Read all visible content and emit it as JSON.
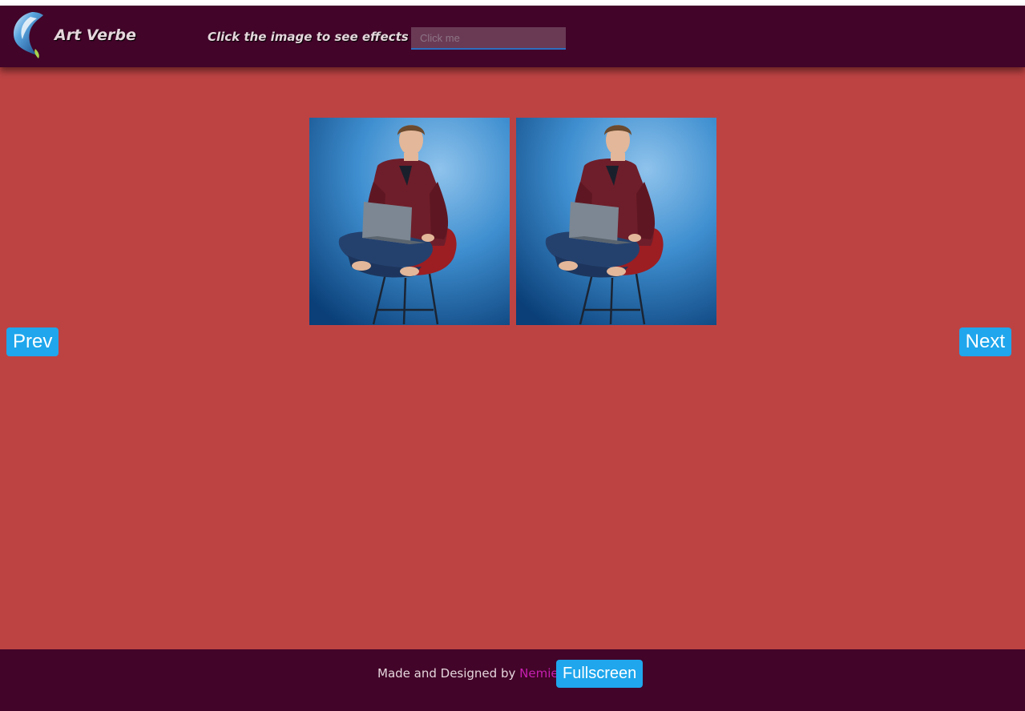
{
  "header": {
    "brand": "Art Verbe",
    "instruction": "Click the image to see effects",
    "click_input": {
      "placeholder": "Click me",
      "value": ""
    },
    "logo_icon": "feather-logo-icon"
  },
  "gallery": {
    "images": [
      {
        "alt": "man-sitting-on-chair-with-laptop"
      },
      {
        "alt": "man-sitting-on-chair-with-laptop"
      }
    ],
    "prev_label": "Prev",
    "next_label": "Next"
  },
  "footer": {
    "credit_prefix": "Made and Designed by",
    "author": "Nemie",
    "fullscreen_label": "Fullscreen"
  },
  "colors": {
    "page_background": "#bd4343",
    "header_background": "#420429",
    "button_accent": "#1fa6ec",
    "author_link": "#c71fb0"
  }
}
